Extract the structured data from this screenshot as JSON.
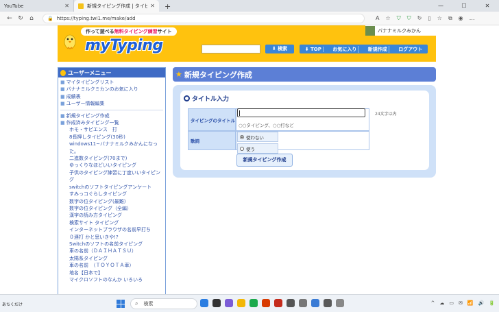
{
  "browser": {
    "tabs": [
      {
        "label": "YouTube",
        "active": false
      },
      {
        "label": "新規タイピング作成 | タイピング練習",
        "active": true
      }
    ],
    "new_tab": "+",
    "window_controls": [
      "—",
      "☐",
      "✕"
    ],
    "url": "https://typing.twi1.me/make/add"
  },
  "header": {
    "tagline_pre": "作って遊べる",
    "tagline_highlight": "無料タイピング練習",
    "tagline_post": "サイト",
    "logo": "myTyping",
    "username": "バナナミルクみかん",
    "search_button": "⬇ 検索",
    "nav": [
      "⬇ TOP",
      "お気に入り",
      "新規作成",
      "ログアウト"
    ]
  },
  "sidebar": {
    "title": "ユーザーメニュー",
    "menu_top": [
      "マイタイピングリスト",
      "バナナミルクミカンのお気に入り",
      "成績表",
      "ユーザー情報編集"
    ],
    "menu_bottom": [
      "新規タイピング作成",
      "作成済みタイピング一覧"
    ],
    "created": [
      "ホモ・サピエンス　打",
      "8長押しタイピング(30秒)",
      "windows11~バナナミルクみかんになった。",
      "二進数タイピング(70まで)",
      "ゆっくりなほどいいタイピング",
      "子供のタイピング練習に丁度いいタイピング",
      "switchのソフトタイピングアンケート",
      "すみっコぐらしタイピング",
      "数字の位タイピング(最難)",
      "数字の位タイピング（全編）",
      "漢字の読み方タイピング",
      "検索サイト タイピング",
      "インターネットブラウザの名前早打ち",
      "０連打 かと思いきや!?",
      "Switchのソフトの名前タイピング",
      "車の名前（ＤＡＩＨＡＴＳＵ）",
      "太陽系タイピング",
      "車の名前　（ＴＯＹＯＴＡ車）",
      "地名【日本で】",
      "マイクロソフトのなんか いろいろ"
    ]
  },
  "main": {
    "title": "新規タイピング作成",
    "section": "タイトル入力",
    "title_label": "タイピングのタイトル",
    "title_value": "",
    "limit": "24文字以内",
    "hint": "○○タイピング、○○打など",
    "lyrics_label": "歌詞",
    "radio_options": [
      "使わない",
      "使う"
    ],
    "radio_selected": 0,
    "create_button": "新規タイピング作成"
  },
  "taskbar": {
    "weather": "あちくだけ",
    "search_label": "検索",
    "tray": [
      "^",
      "☁",
      "▭",
      "✉",
      "📶",
      "🔊",
      "🔋"
    ]
  }
}
